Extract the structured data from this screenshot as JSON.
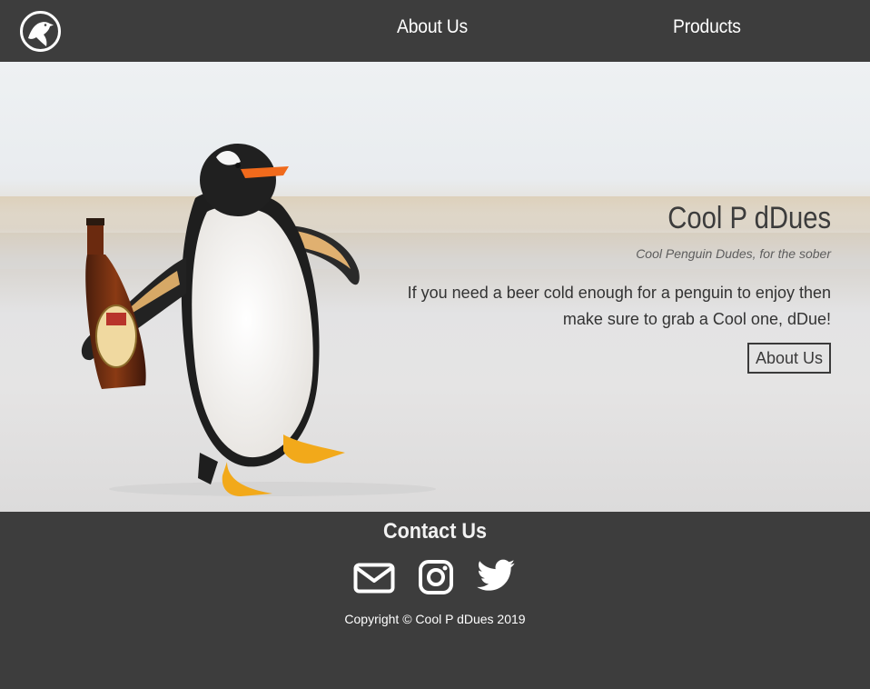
{
  "header": {
    "logo_icon": "penguin-logo-icon",
    "nav": [
      {
        "label": "About Us"
      },
      {
        "label": "Products"
      }
    ]
  },
  "hero": {
    "title": "Cool P dDues",
    "tagline": "Cool Penguin Dudes, for the sober",
    "body": "If you need a beer cold enough for a penguin to enjoy then make sure to grab a Cool one, dDue!",
    "button_label": "About Us"
  },
  "footer": {
    "title": "Contact Us",
    "icons": [
      "mail-icon",
      "instagram-icon",
      "twitter-icon"
    ],
    "copyright": "Copyright © Cool P dDues 2019"
  },
  "colors": {
    "bar_background": "#3d3d3d",
    "nav_text": "#ffffff",
    "hero_text": "#3c3c3c"
  }
}
